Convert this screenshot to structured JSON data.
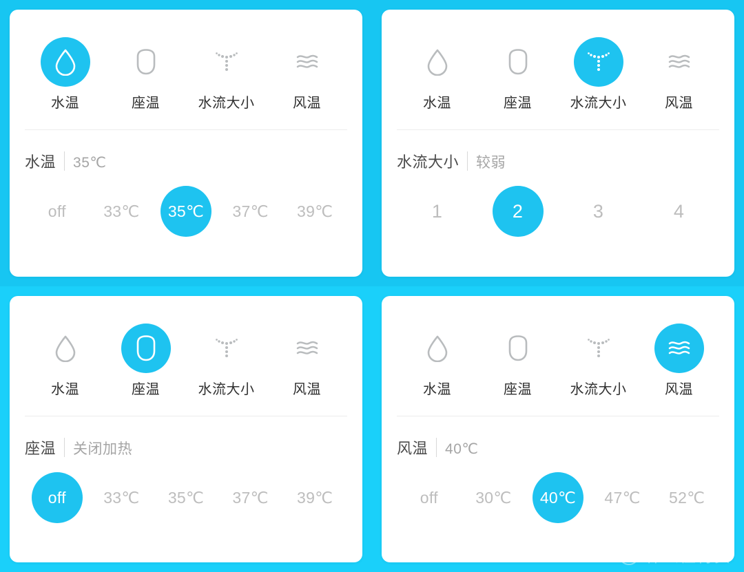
{
  "theme": {
    "accent": "#1ec3f0",
    "background_top": "#17c6f2",
    "background_bottom": "#1ad0fa",
    "card_background": "#ffffff",
    "label_color": "#303030",
    "muted_color": "#bdbdbd"
  },
  "watermark": {
    "badge": "值",
    "text": "什么值得买"
  },
  "tabs": [
    {
      "label": "水温",
      "icon": "water-drop-icon"
    },
    {
      "label": "座温",
      "icon": "toilet-seat-icon"
    },
    {
      "label": "水流大小",
      "icon": "water-spray-icon"
    },
    {
      "label": "风温",
      "icon": "wind-waves-icon"
    }
  ],
  "panels": [
    {
      "id": "water-temperature",
      "active_tab_index": 0,
      "value_label": "水温",
      "value_separator": "|",
      "value_text": "35℃",
      "selected_index": 2,
      "options": [
        "off",
        "33℃",
        "35℃",
        "37℃",
        "39℃"
      ]
    },
    {
      "id": "water-flow",
      "active_tab_index": 2,
      "value_label": "水流大小",
      "value_separator": "|",
      "value_text": "较弱",
      "selected_index": 1,
      "options": [
        "1",
        "2",
        "3",
        "4"
      ]
    },
    {
      "id": "seat-temperature",
      "active_tab_index": 1,
      "value_label": "座温",
      "value_separator": "|",
      "value_text": "关闭加热",
      "selected_index": 0,
      "options": [
        "off",
        "33℃",
        "35℃",
        "37℃",
        "39℃"
      ]
    },
    {
      "id": "wind-temperature",
      "active_tab_index": 3,
      "value_label": "风温",
      "value_separator": "|",
      "value_text": "40℃",
      "selected_index": 2,
      "options": [
        "off",
        "30℃",
        "40℃",
        "47℃",
        "52℃"
      ]
    }
  ]
}
